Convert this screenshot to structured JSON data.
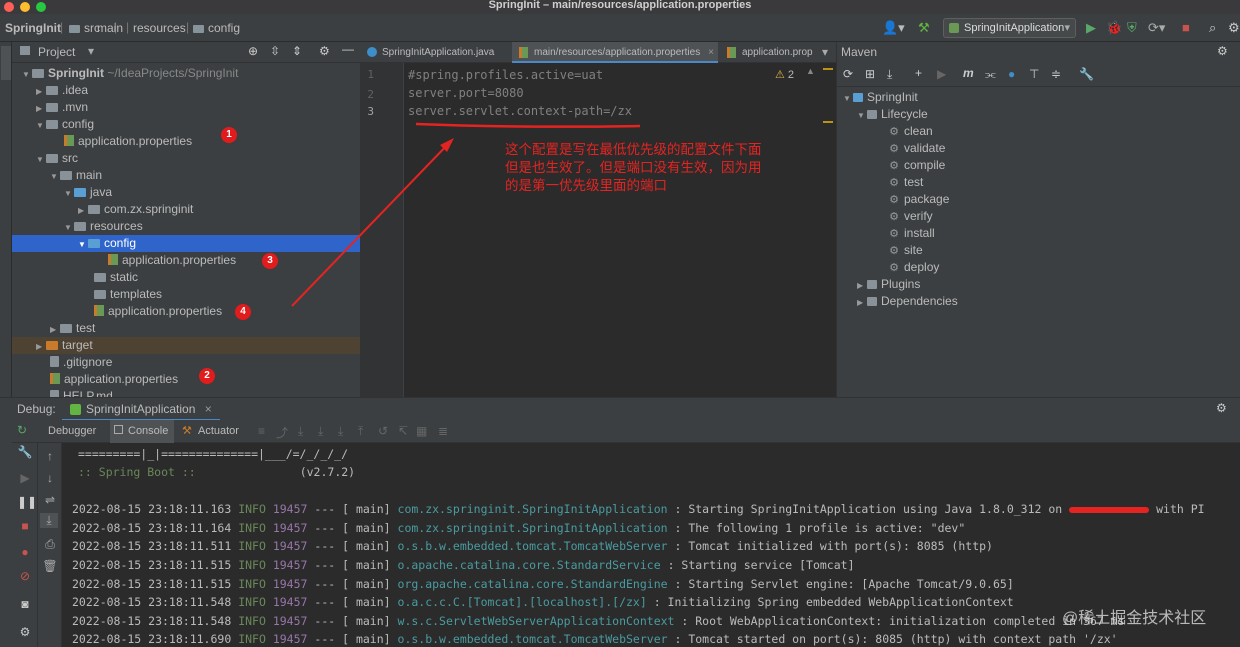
{
  "window": {
    "title": "SpringInit – main/resources/application.properties"
  },
  "breadcrumb": [
    "SpringInit",
    "src",
    "main",
    "resources",
    "config"
  ],
  "run_config": {
    "label": "SpringInitApplication"
  },
  "project": {
    "label": "Project",
    "tree": [
      {
        "label": "SpringInit",
        "extra": "~/IdeaProjects/SpringInit",
        "icon": "module"
      },
      {
        "label": ".idea",
        "icon": "folder"
      },
      {
        "label": ".mvn",
        "icon": "folder"
      },
      {
        "label": "config",
        "icon": "folder"
      },
      {
        "label": "application.properties",
        "icon": "properties"
      },
      {
        "label": "src",
        "icon": "folder"
      },
      {
        "label": "main",
        "icon": "folder"
      },
      {
        "label": "java",
        "icon": "folder-blue"
      },
      {
        "label": "com.zx.springinit",
        "icon": "package"
      },
      {
        "label": "resources",
        "icon": "folder"
      },
      {
        "label": "config",
        "icon": "folder"
      },
      {
        "label": "application.properties",
        "icon": "properties"
      },
      {
        "label": "static",
        "icon": "folder"
      },
      {
        "label": "templates",
        "icon": "folder"
      },
      {
        "label": "application.properties",
        "icon": "properties"
      },
      {
        "label": "test",
        "icon": "folder"
      },
      {
        "label": "target",
        "icon": "folder-orange"
      },
      {
        "label": ".gitignore",
        "icon": "file"
      },
      {
        "label": "application.properties",
        "icon": "properties"
      },
      {
        "label": "HELP.md",
        "icon": "file"
      }
    ],
    "badges": [
      "1",
      "3",
      "4",
      "2"
    ]
  },
  "editor": {
    "tabs": [
      "SpringInitApplication.java",
      "main/resources/application.properties",
      "application.prop"
    ],
    "warnings": "2",
    "lines": [
      {
        "num": "1",
        "text": "#spring.profiles.active=uat"
      },
      {
        "num": "2",
        "text": "server.port=8080"
      },
      {
        "num": "3",
        "text": "server.servlet.context-path=/zx"
      }
    ]
  },
  "annotation": {
    "lines": [
      "这个配置是写在最低优先级的配置文件下面",
      "但是也生效了。但是端口没有生效，因为用",
      "的是第一优先级里面的端口"
    ]
  },
  "maven": {
    "title": "Maven",
    "root": "SpringInit",
    "lifecycle": "Lifecycle",
    "goals": [
      "clean",
      "validate",
      "compile",
      "test",
      "package",
      "verify",
      "install",
      "site",
      "deploy"
    ],
    "plugins": "Plugins",
    "dependencies": "Dependencies"
  },
  "debug": {
    "label": "Debug:",
    "session": "SpringInitApplication",
    "tabs": [
      "Debugger",
      "Console",
      "Actuator"
    ]
  },
  "console": {
    "banner1": "=========|_|==============|___/=/_/_/_/",
    "banner2_a": ":: Spring Boot ::",
    "banner2_b": "(v2.7.2)",
    "logs": [
      {
        "ts": "2022-08-15 23:18:11.163",
        "lvl": "INFO",
        "pid": "19457",
        "sep": "--- [",
        "thread": "main]",
        "cls": "com.zx.springinit.SpringInitApplication",
        "msg": ": Starting SpringInitApplication using Java 1.8.0_312 on",
        "tail": "with PI"
      },
      {
        "ts": "2022-08-15 23:18:11.164",
        "lvl": "INFO",
        "pid": "19457",
        "sep": "--- [",
        "thread": "main]",
        "cls": "com.zx.springinit.SpringInitApplication",
        "msg": ": The following 1 profile is active: \"dev\"",
        "tail": ""
      },
      {
        "ts": "2022-08-15 23:18:11.511",
        "lvl": "INFO",
        "pid": "19457",
        "sep": "--- [",
        "thread": "main]",
        "cls": "o.s.b.w.embedded.tomcat.TomcatWebServer",
        "msg": ": Tomcat initialized with port(s): 8085 (http)",
        "tail": ""
      },
      {
        "ts": "2022-08-15 23:18:11.515",
        "lvl": "INFO",
        "pid": "19457",
        "sep": "--- [",
        "thread": "main]",
        "cls": "o.apache.catalina.core.StandardService",
        "msg": ": Starting service [Tomcat]",
        "tail": ""
      },
      {
        "ts": "2022-08-15 23:18:11.515",
        "lvl": "INFO",
        "pid": "19457",
        "sep": "--- [",
        "thread": "main]",
        "cls": "org.apache.catalina.core.StandardEngine",
        "msg": ": Starting Servlet engine: [Apache Tomcat/9.0.65]",
        "tail": ""
      },
      {
        "ts": "2022-08-15 23:18:11.548",
        "lvl": "INFO",
        "pid": "19457",
        "sep": "--- [",
        "thread": "main]",
        "cls": "o.a.c.c.C.[Tomcat].[localhost].[/zx]",
        "msg": ": Initializing Spring embedded WebApplicationContext",
        "tail": ""
      },
      {
        "ts": "2022-08-15 23:18:11.548",
        "lvl": "INFO",
        "pid": "19457",
        "sep": "--- [",
        "thread": "main]",
        "cls": "w.s.c.ServletWebServerApplicationContext",
        "msg": ": Root WebApplicationContext: initialization completed in 367 ms",
        "tail": ""
      },
      {
        "ts": "2022-08-15 23:18:11.690",
        "lvl": "INFO",
        "pid": "19457",
        "sep": "--- [",
        "thread": "main]",
        "cls": "o.s.b.w.embedded.tomcat.TomcatWebServer",
        "msg": ": Tomcat started on port(s): 8085 (http) with context path '/zx'",
        "tail": ""
      }
    ]
  },
  "watermark": "@稀土掘金技术社区"
}
